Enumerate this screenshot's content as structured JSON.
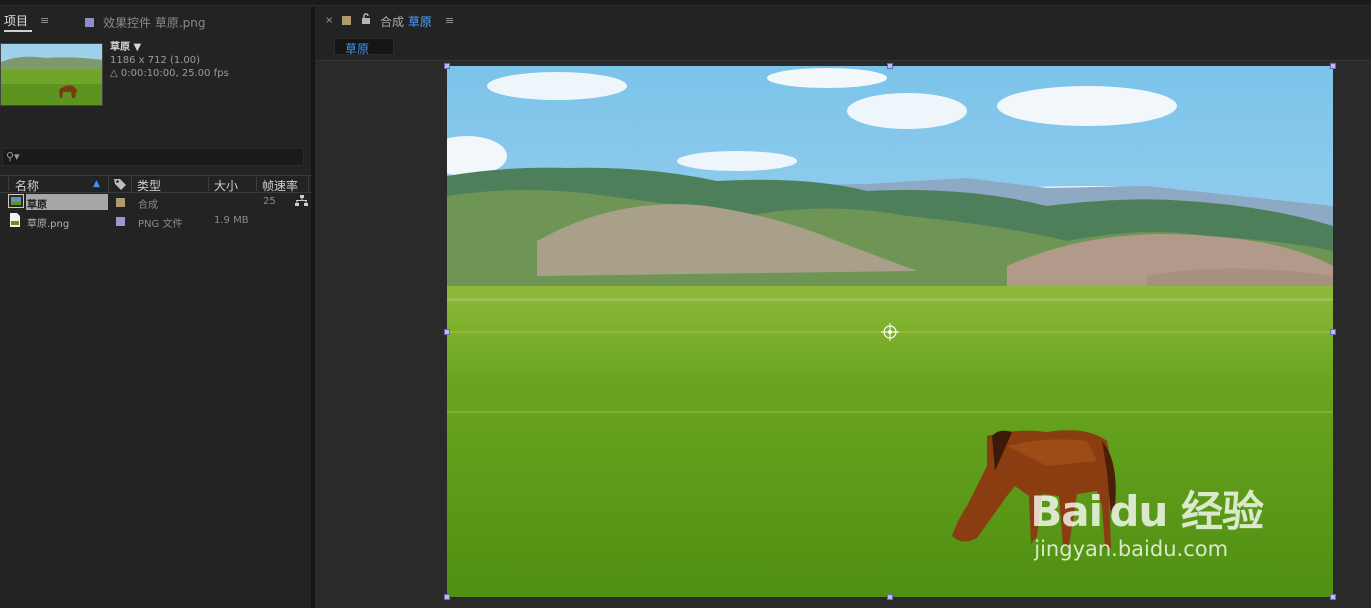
{
  "project_panel": {
    "tab_label": "项目",
    "menu_icon": "≡",
    "effects_tab_label": "效果控件 草原.png",
    "effects_swatch_color": "#8f8fc7",
    "selected": {
      "name": "草原",
      "dims": "1186 x 712 (1.00)",
      "duration": "△ 0:00:10:00, 25.00 fps"
    },
    "search_icon": "⚲▾",
    "columns": {
      "name": "名称",
      "type": "类型",
      "size": "大小",
      "fps": "帧速率"
    },
    "items": [
      {
        "name": "草原",
        "type": "合成",
        "size": "",
        "fps": "25",
        "swatch": "#b09a70"
      },
      {
        "name": "草原.png",
        "type": "PNG 文件",
        "size": "1.9 MB",
        "fps": "",
        "swatch": "#9a9ad0"
      }
    ]
  },
  "comp_panel": {
    "close": "×",
    "swatch_color": "#b09a70",
    "lock_icon": "🔓",
    "label_prefix": "合成",
    "label_name": "草原",
    "menu_icon": "≡",
    "sub_tab": "草原"
  },
  "watermark": {
    "brand": "Bai du 经验",
    "url": "jingyan.baidu.com"
  }
}
